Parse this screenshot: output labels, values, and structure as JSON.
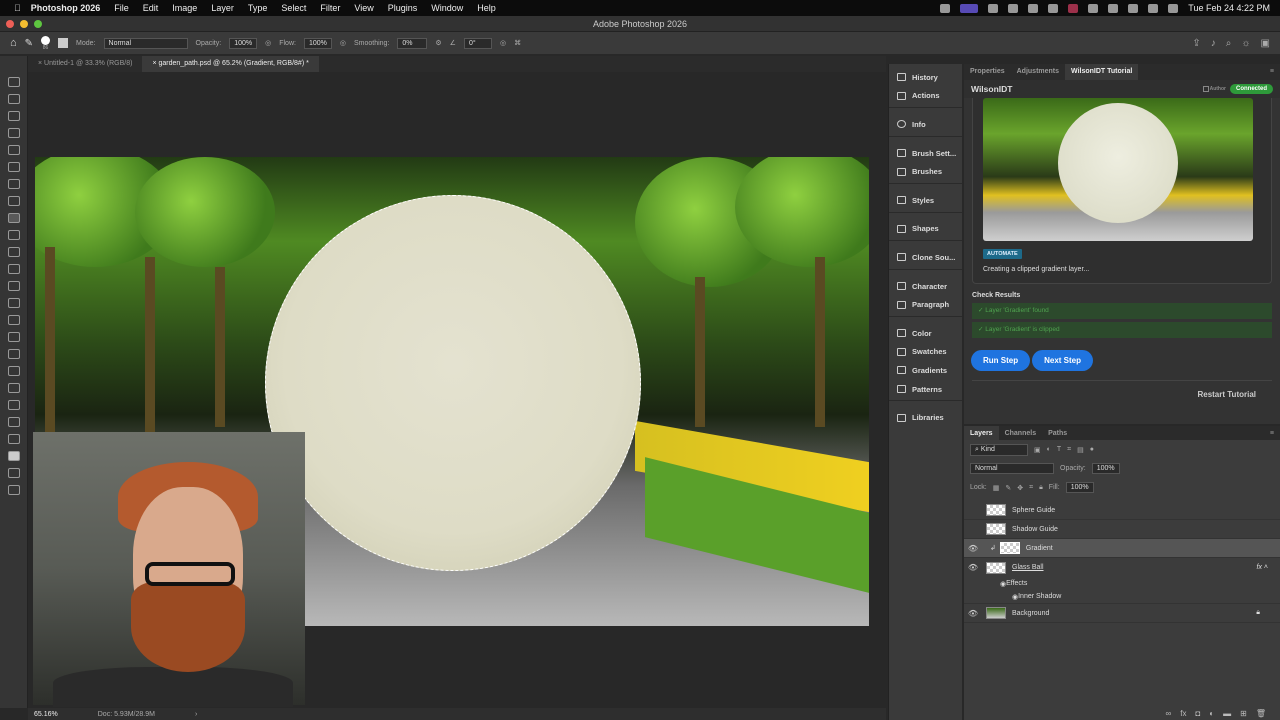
{
  "menubar": {
    "app": "Photoshop 2026",
    "items": [
      "File",
      "Edit",
      "Image",
      "Layer",
      "Type",
      "Select",
      "Filter",
      "View",
      "Plugins",
      "Window",
      "Help"
    ],
    "clock": "Tue Feb 24  4:22 PM"
  },
  "titlebar": {
    "title": "Adobe Photoshop 2026"
  },
  "options": {
    "brush_size": "86",
    "mode_label": "Mode:",
    "mode": "Normal",
    "opacity_label": "Opacity:",
    "opacity": "100%",
    "flow_label": "Flow:",
    "flow": "100%",
    "smoothing_label": "Smoothing:",
    "smoothing": "0%",
    "angle": "0°"
  },
  "tabs": [
    {
      "label": "Untitled-1 @ 33.3% (RGB/8)"
    },
    {
      "label": "garden_path.psd @ 65.2% (Gradient, RGB/8#) *"
    }
  ],
  "status": {
    "zoom": "65.16%",
    "doc": "Doc: 5.93M/28.9M"
  },
  "dock": [
    "History",
    "Actions",
    "Info",
    "Brush Sett...",
    "Brushes",
    "Styles",
    "Shapes",
    "Clone Sou...",
    "Character",
    "Paragraph",
    "Color",
    "Swatches",
    "Gradients",
    "Patterns",
    "Libraries"
  ],
  "panel": {
    "tabs": [
      "Properties",
      "Adjustments",
      "WilsonIDT Tutorial"
    ],
    "title": "WilsonIDT",
    "author": "Author",
    "status": "Connected",
    "badge": "AUTOMATE",
    "caption": "Creating a clipped gradient layer...",
    "check_title": "Check Results",
    "checks": [
      "✓ Layer 'Gradient' found",
      "✓ Layer 'Gradient' is clipped"
    ],
    "run": "Run Step",
    "next": "Next Step",
    "restart": "Restart Tutorial"
  },
  "layers": {
    "tabs": [
      "Layers",
      "Channels",
      "Paths"
    ],
    "filter": "Kind",
    "blend": "Normal",
    "opacity_label": "Opacity:",
    "opacity": "100%",
    "lock_label": "Lock:",
    "fill_label": "Fill:",
    "fill": "100%",
    "items": [
      {
        "name": "Sphere Guide"
      },
      {
        "name": "Shadow Guide"
      },
      {
        "name": "Gradient"
      },
      {
        "name": "Glass Ball"
      },
      {
        "name": "Effects"
      },
      {
        "name": "Inner Shadow"
      },
      {
        "name": "Background"
      }
    ]
  }
}
